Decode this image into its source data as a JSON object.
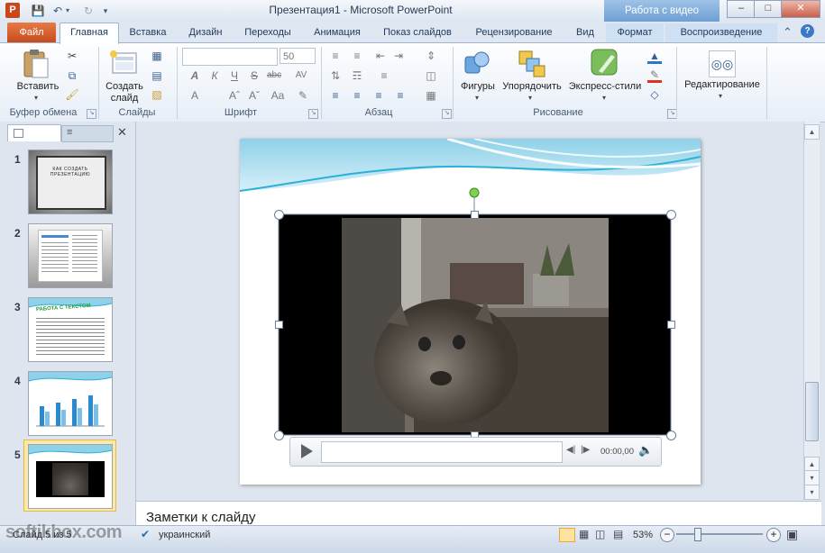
{
  "app": {
    "window_title": "Презентация1 - Microsoft PowerPoint",
    "context_tab_group": "Работа с видео",
    "app_icon_letter": "P"
  },
  "ribbon_tabs": [
    {
      "label": "Файл"
    },
    {
      "label": "Главная"
    },
    {
      "label": "Вставка"
    },
    {
      "label": "Дизайн"
    },
    {
      "label": "Переходы"
    },
    {
      "label": "Анимация"
    },
    {
      "label": "Показ слайдов"
    },
    {
      "label": "Рецензирование"
    },
    {
      "label": "Вид"
    },
    {
      "label": "Формат"
    },
    {
      "label": "Воспроизведение"
    }
  ],
  "ribbon": {
    "clipboard": {
      "paste_label": "Вставить",
      "group_label": "Буфер обмена"
    },
    "slides": {
      "new_slide_label": "Создать слайд",
      "group_label": "Слайды"
    },
    "font": {
      "font_name": "",
      "font_size": "50",
      "group_label": "Шрифт"
    },
    "paragraph": {
      "group_label": "Абзац"
    },
    "drawing": {
      "shapes_label": "Фигуры",
      "arrange_label": "Упорядочить",
      "quick_styles_label": "Экспресс-стили",
      "group_label": "Рисование"
    },
    "editing": {
      "label": "Редактирование"
    }
  },
  "thumbnails": [
    {
      "number": "1",
      "text": "КАК СОЗДАТЬ ПРЕЗЕНТАЦИЮ"
    },
    {
      "number": "2",
      "text": ""
    },
    {
      "number": "3",
      "text": "РАБОТА С ТЕКСТОМ"
    },
    {
      "number": "4",
      "text": ""
    },
    {
      "number": "5",
      "text": ""
    }
  ],
  "video_player": {
    "time": "00:00,00"
  },
  "notes": {
    "placeholder": "Заметки к слайду"
  },
  "statusbar": {
    "slide_info": "Слайд 5 из 5",
    "language": "украинский",
    "zoom": "53%"
  },
  "watermark": "softikbox.com",
  "colors": {
    "file_tab": "#c64b1b",
    "context_tab": "#6d9fd4",
    "accent_wave": "#2bb0d6",
    "selected_thumb": "#fde9a6"
  }
}
